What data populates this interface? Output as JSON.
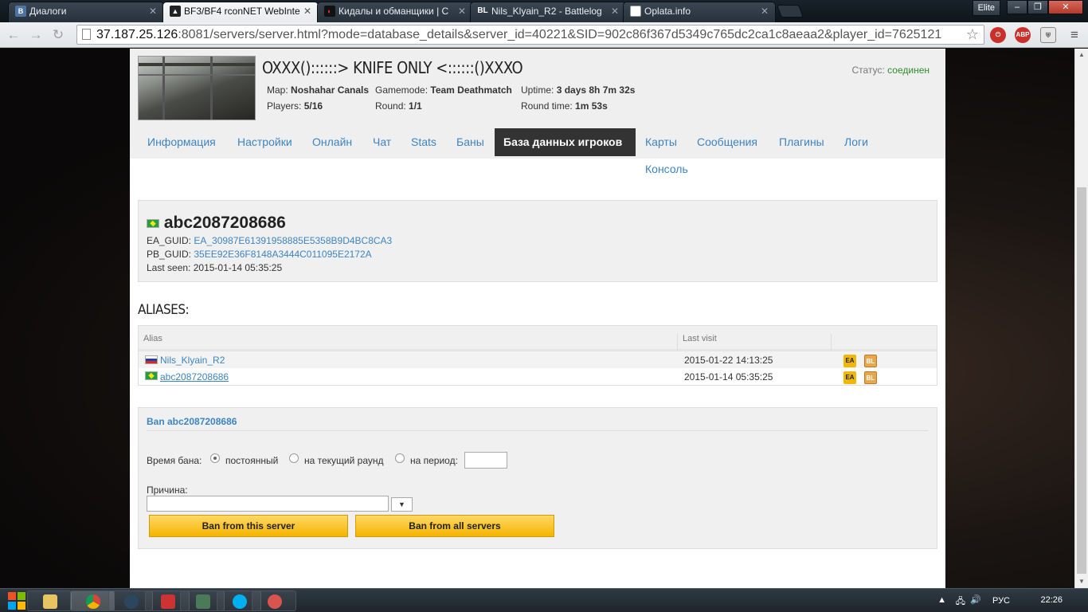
{
  "browser": {
    "tabs": [
      {
        "label": "Диалоги",
        "favicon": "vk",
        "active": false
      },
      {
        "label": "BF3/BF4 rconNET WebInte",
        "favicon": "bf",
        "active": true
      },
      {
        "label": "Кидалы и обманщики | C",
        "favicon": "cs",
        "active": false
      },
      {
        "label": "Nils_Klyain_R2 - Battlelog",
        "favicon": "bl",
        "active": false
      },
      {
        "label": "Oplata.info",
        "favicon": "doc",
        "active": false
      }
    ],
    "profile": "Elite",
    "url_host": "37.187.25.126",
    "url_rest": ":8081/servers/server.html?mode=database_details&server_id=40221&SID=902c86f367d5349c765dc2ca1c8aeaa2&player_id=7625121",
    "extensions": [
      "ABP"
    ],
    "colors": {
      "active_tab": "#eceef0",
      "link": "#3d84c0",
      "status_ok": "#2e8b2e",
      "button": "#f5b400"
    }
  },
  "server": {
    "name": "OXXX()::::::> KNIFE ONLY <::::::()XXXO",
    "map_label": "Map:",
    "map": "Noshahar Canals",
    "gamemode_label": "Gamemode:",
    "gamemode": "Team Deathmatch",
    "uptime_label": "Uptime:",
    "uptime": "3 days 8h 7m 32s",
    "players_label": "Players:",
    "players": "5/16",
    "round_label": "Round:",
    "round": "1/1",
    "roundtime_label": "Round time:",
    "roundtime": "1m 53s",
    "status_label": "Статус:",
    "status": "соединен"
  },
  "nav": {
    "items": [
      "Информация",
      "Настройки",
      "Онлайн",
      "Чат",
      "Stats",
      "Баны",
      "База данных игроков",
      "Карты",
      "Сообщения",
      "Плагины",
      "Логи",
      "Консоль"
    ],
    "active": "База данных игроков"
  },
  "player": {
    "name": "abc2087208686",
    "country": "br",
    "ea_guid_label": "EA_GUID:",
    "ea_guid": "EA_30987E61391958885E5358B9D4BC8CA3",
    "pb_guid_label": "PB_GUID:",
    "pb_guid": "35EE92E36F8148A3444C011095E2172A",
    "last_seen_label": "Last seen:",
    "last_seen": "2015-01-14 05:35:25"
  },
  "aliases": {
    "heading": "ALIASES:",
    "columns": [
      "Alias",
      "Last visit",
      ""
    ],
    "rows": [
      {
        "country": "ru",
        "alias": "Nils_Klyain_R2",
        "last_visit": "2015-01-22 14:13:25"
      },
      {
        "country": "br",
        "alias": "abc2087208686",
        "last_visit": "2015-01-14 05:35:25"
      }
    ]
  },
  "ban": {
    "title": "Ban abc2087208686",
    "time_label": "Время бана:",
    "opt_permanent": "постоянный",
    "opt_round": "на текущий раунд",
    "opt_period": "на период:",
    "selected": "постоянный",
    "period_value": "",
    "reason_label": "Причина:",
    "reason_value": "",
    "btn_server": "Ban from this server",
    "btn_all": "Ban from all servers"
  },
  "taskbar": {
    "items": [
      "explorer",
      "chrome",
      "steam",
      "media",
      "network",
      "skype",
      "app"
    ],
    "lang": "РУС",
    "time": "22:26"
  }
}
